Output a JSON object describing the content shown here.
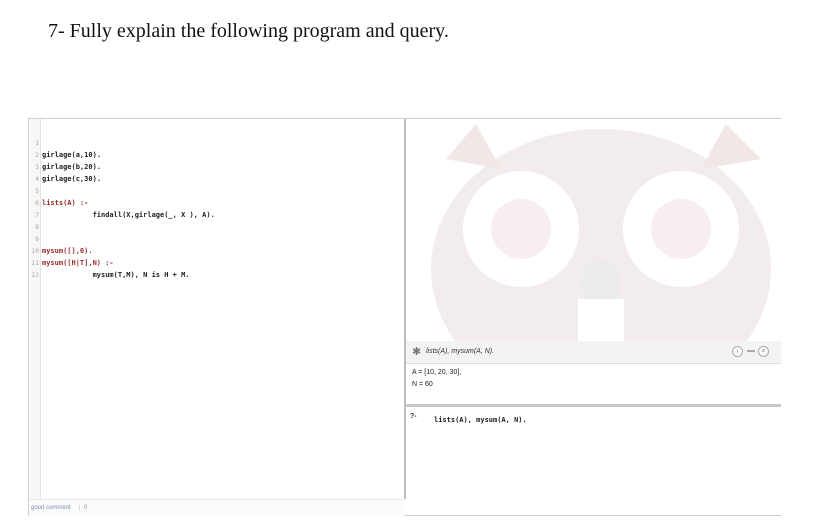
{
  "question": "7- Fully explain the following program and query.",
  "editor": {
    "lines": [
      {
        "num": "1",
        "text": "girlage(a,10)."
      },
      {
        "num": "2",
        "text": "girlage(b,20)."
      },
      {
        "num": "3",
        "text": "girlage(c,30)."
      },
      {
        "num": "4",
        "text": ""
      },
      {
        "num": "5",
        "text": "lists(A) :-"
      },
      {
        "num": "6",
        "text": "            findall(X,girlage(_, X ), A)."
      },
      {
        "num": "7",
        "text": ""
      },
      {
        "num": "8",
        "text": ""
      },
      {
        "num": "9",
        "text": "mysum([],0)."
      },
      {
        "num": "10",
        "text": "mysum([H|T],N) :-"
      },
      {
        "num": "11",
        "text": "            mysum(T,M), N is H + M."
      },
      {
        "num": "12",
        "text": ""
      }
    ],
    "status_left": "good comment",
    "status_right": "0"
  },
  "query": {
    "text": "lists(A), mysum(A, N).",
    "gear_icon": "gear-icon",
    "next_icon": "next-icon",
    "stop_icon": "stop-icon",
    "close_icon": "close-icon"
  },
  "result": {
    "a_line": "A = [10, 20, 30],",
    "n_line": "N = 60"
  },
  "input": {
    "prompt": "?-",
    "text": "lists(A), mysum(A, N)."
  }
}
